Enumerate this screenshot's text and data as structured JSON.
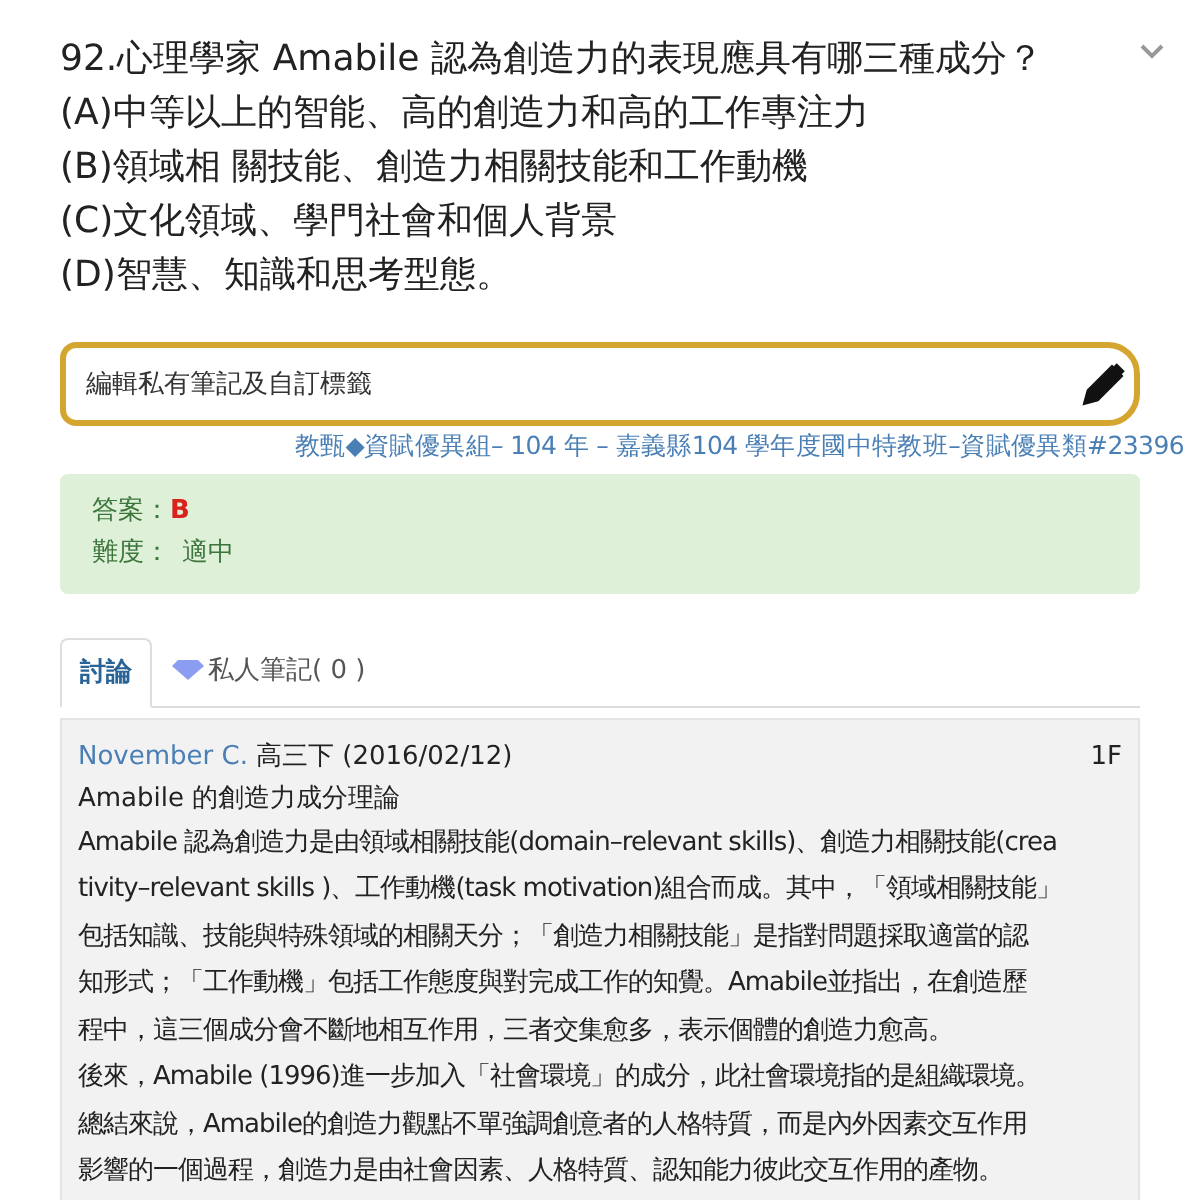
{
  "question": {
    "title": "92.心理學家 Amabile 認為創造力的表現應具有哪三種成分？",
    "options": [
      "(A)中等以上的智能、高的創造力和高的工作專注力",
      "(B)領域相 關技能、創造力相關技能和工作動機",
      "(C)文化領域、學門社會和個人背景",
      "(D)智慧、知識和思考型態。"
    ]
  },
  "note_field": {
    "placeholder": "編輯私有筆記及自訂標籤"
  },
  "source": "教甄◆資賦優異組– 104 年 – 嘉義縣104 學年度國中特教班–資賦優異類#23396",
  "answer": {
    "label": "答案：",
    "value": "B"
  },
  "difficulty": {
    "label": "難度：",
    "value": "適中"
  },
  "tabs": [
    {
      "label": "討論",
      "selected": true,
      "kind": "text"
    },
    {
      "label": "私人筆記( 0 )",
      "selected": false,
      "kind": "gem"
    }
  ],
  "post": {
    "author": "November C.",
    "meta": "高三下 (2016/02/12)",
    "floor": "1F",
    "title": "Amabile 的創造力成分理論",
    "lines": [
      "Amabile 認為創造力是由領域相關技能(domain–relevant skills)、創造力相關技能(crea",
      "tivity–relevant skills )、工作動機(task motivation)組合而成。其中，「領域相關技能」",
      "包括知識、技能與特殊領域的相關天分；「創造力相關技能」是指對問題採取適當的認",
      "知形式；「工作動機」包括工作態度與對完成工作的知覺。Amabile並指出，在創造歷",
      "程中，這三個成分會不斷地相互作用，三者交集愈多，表示個體的創造力愈高。",
      "後來，Amabile (1996)進一步加入「社會環境」的成分，此社會環境指的是組織環境。",
      "總結來說，Amabile的創造力觀點不單強調創意者的人格特質，而是內外因素交互作用",
      "影響的一個過程，創造力是由社會因素、人格特質、認知能力彼此交互作用的產物。"
    ]
  }
}
